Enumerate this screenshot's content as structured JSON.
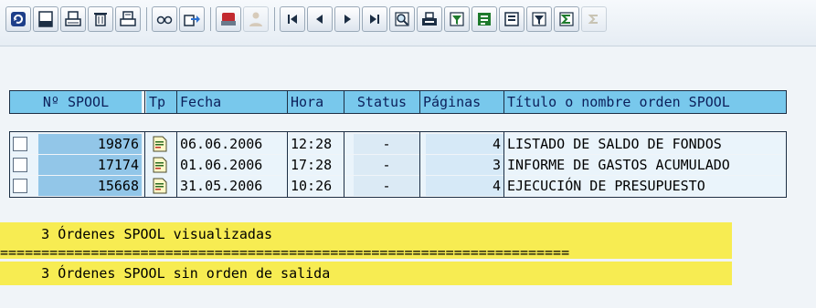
{
  "toolbar": {
    "buttons": [
      {
        "name": "refresh-icon",
        "disabled": false
      },
      {
        "name": "display-contents-icon",
        "disabled": false
      },
      {
        "name": "print-directly-icon",
        "disabled": false
      },
      {
        "name": "delete-icon",
        "disabled": false
      },
      {
        "name": "print-with-changed-attributes-icon",
        "disabled": false
      },
      {
        "name": "details-icon",
        "disabled": false
      },
      {
        "name": "export-icon",
        "disabled": false
      },
      {
        "name": "output-device-icon",
        "disabled": false
      },
      {
        "name": "change-owner-icon",
        "disabled": true
      },
      {
        "name": "first-page-icon",
        "disabled": false
      },
      {
        "name": "previous-page-icon",
        "disabled": false
      },
      {
        "name": "next-page-icon",
        "disabled": false
      },
      {
        "name": "last-page-icon",
        "disabled": false
      },
      {
        "name": "find-icon",
        "disabled": false
      },
      {
        "name": "print-icon",
        "disabled": false
      },
      {
        "name": "filter-icon",
        "disabled": false
      },
      {
        "name": "export-list-icon",
        "disabled": false
      },
      {
        "name": "local-file-icon",
        "disabled": false
      },
      {
        "name": "set-filter-icon",
        "disabled": false
      },
      {
        "name": "sum-icon",
        "disabled": false
      },
      {
        "name": "subtotal-icon",
        "disabled": true
      }
    ]
  },
  "table": {
    "headers": {
      "spool_no": "Nº SPOOL",
      "type": "Tp",
      "date": "Fecha",
      "time": "Hora",
      "status": "Status",
      "pages": "Páginas",
      "title": "Título o nombre orden SPOOL"
    },
    "rows": [
      {
        "spool_no": "19876",
        "date": "06.06.2006",
        "time": "12:28",
        "status": "-",
        "pages": "4",
        "title": "LISTADO DE SALDO DE FONDOS"
      },
      {
        "spool_no": "17174",
        "date": "01.06.2006",
        "time": "17:28",
        "status": "-",
        "pages": "3",
        "title": "INFORME DE GASTOS ACUMULADO"
      },
      {
        "spool_no": "15668",
        "date": "31.05.2006",
        "time": "10:26",
        "status": "-",
        "pages": "4",
        "title": "EJECUCIÓN DE PRESUPUESTO"
      }
    ]
  },
  "summary": {
    "displayed": "     3 Órdenes SPOOL visualizadas",
    "divider": "=====================================================================",
    "no_output": "     3 Órdenes SPOOL sin orden de salida"
  },
  "colors": {
    "header_bg": "#78c8ec",
    "spool_cell_bg": "#92c6e8",
    "summary_bg": "#f7ec52"
  }
}
